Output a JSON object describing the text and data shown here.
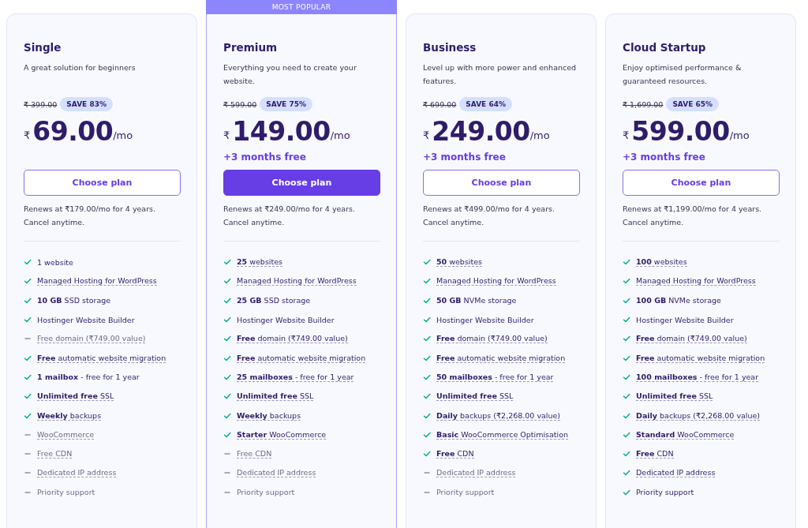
{
  "plans": [
    {
      "name": "Single",
      "popular": false,
      "description": "A great solution for beginners",
      "old_price": "₹ 399.00",
      "save": "SAVE 83%",
      "currency": "₹",
      "price": "69.00",
      "period": "/mo",
      "button": "Choose plan",
      "primary": false,
      "renews": "Renews at ₹179.00/mo for 4 years. Cancel anytime.",
      "features": [
        {
          "text": "1 website",
          "included": true,
          "dashed": false
        },
        {
          "text": "Managed Hosting for WordPress",
          "included": true,
          "dashed": true
        },
        {
          "text": "**10 GB** SSD storage",
          "included": true,
          "dashed": false
        },
        {
          "text": "Hostinger Website Builder",
          "included": true,
          "dashed": false
        },
        {
          "text": "Free domain (₹749.00 value)",
          "included": false,
          "dashed": true
        },
        {
          "text": "**Free** automatic website migration",
          "included": true,
          "dashed": true
        },
        {
          "text": "**1 mailbox** - free for 1 year",
          "included": true,
          "dashed": false
        },
        {
          "text": "**Unlimited free** SSL",
          "included": true,
          "dashed": true
        },
        {
          "text": "**Weekly** backups",
          "included": true,
          "dashed": true
        },
        {
          "text": "WooCommerce",
          "included": false,
          "dashed": true
        },
        {
          "text": "Free CDN",
          "included": false,
          "dashed": true
        },
        {
          "text": "Dedicated IP address",
          "included": false,
          "dashed": true
        },
        {
          "text": "Priority support",
          "included": false,
          "dashed": false
        }
      ]
    },
    {
      "name": "Premium",
      "popular": true,
      "ribbon": "MOST POPULAR",
      "description": "Everything you need to create your website.",
      "old_price": "₹ 599.00",
      "save": "SAVE 75%",
      "currency": "₹",
      "price": "149.00",
      "period": "/mo",
      "bonus": "+3 months free",
      "button": "Choose plan",
      "primary": true,
      "renews": "Renews at ₹249.00/mo for 4 years. Cancel anytime.",
      "features": [
        {
          "text": "**25** websites",
          "included": true,
          "dashed": true
        },
        {
          "text": "Managed Hosting for WordPress",
          "included": true,
          "dashed": true
        },
        {
          "text": "**25 GB** SSD storage",
          "included": true,
          "dashed": false
        },
        {
          "text": "Hostinger Website Builder",
          "included": true,
          "dashed": false
        },
        {
          "text": "**Free** domain (₹749.00 value)",
          "included": true,
          "dashed": true
        },
        {
          "text": "**Free** automatic website migration",
          "included": true,
          "dashed": true
        },
        {
          "text": "**25 mailboxes** - free for 1 year",
          "included": true,
          "dashed": true
        },
        {
          "text": "**Unlimited free** SSL",
          "included": true,
          "dashed": true
        },
        {
          "text": "**Weekly** backups",
          "included": true,
          "dashed": true
        },
        {
          "text": "**Starter** WooCommerce",
          "included": true,
          "dashed": true
        },
        {
          "text": "Free CDN",
          "included": false,
          "dashed": true
        },
        {
          "text": "Dedicated IP address",
          "included": false,
          "dashed": true
        },
        {
          "text": "Priority support",
          "included": false,
          "dashed": false
        }
      ]
    },
    {
      "name": "Business",
      "popular": false,
      "description": "Level up with more power and enhanced features.",
      "old_price": "₹ 699.00",
      "save": "SAVE 64%",
      "currency": "₹",
      "price": "249.00",
      "period": "/mo",
      "bonus": "+3 months free",
      "button": "Choose plan",
      "primary": false,
      "renews": "Renews at ₹499.00/mo for 4 years. Cancel anytime.",
      "features": [
        {
          "text": "**50** websites",
          "included": true,
          "dashed": true
        },
        {
          "text": "Managed Hosting for WordPress",
          "included": true,
          "dashed": true
        },
        {
          "text": "**50 GB** NVMe storage",
          "included": true,
          "dashed": false
        },
        {
          "text": "Hostinger Website Builder",
          "included": true,
          "dashed": false
        },
        {
          "text": "**Free** domain (₹749.00 value)",
          "included": true,
          "dashed": true
        },
        {
          "text": "**Free** automatic website migration",
          "included": true,
          "dashed": true
        },
        {
          "text": "**50 mailboxes** - free for 1 year",
          "included": true,
          "dashed": true
        },
        {
          "text": "**Unlimited free** SSL",
          "included": true,
          "dashed": true
        },
        {
          "text": "**Daily** backups (₹2,268.00 value)",
          "included": true,
          "dashed": true
        },
        {
          "text": "**Basic** WooCommerce Optimisation",
          "included": true,
          "dashed": true
        },
        {
          "text": "**Free** CDN",
          "included": true,
          "dashed": true
        },
        {
          "text": "Dedicated IP address",
          "included": false,
          "dashed": true
        },
        {
          "text": "Priority support",
          "included": false,
          "dashed": false
        }
      ]
    },
    {
      "name": "Cloud Startup",
      "popular": false,
      "description": "Enjoy optimised performance & guaranteed resources.",
      "old_price": "₹ 1,699.00",
      "save": "SAVE 65%",
      "currency": "₹",
      "price": "599.00",
      "period": "/mo",
      "bonus": "+3 months free",
      "button": "Choose plan",
      "primary": false,
      "renews": "Renews at ₹1,199.00/mo for 4 years. Cancel anytime.",
      "features": [
        {
          "text": "**100** websites",
          "included": true,
          "dashed": true
        },
        {
          "text": "Managed Hosting for WordPress",
          "included": true,
          "dashed": true
        },
        {
          "text": "**100 GB** NVMe storage",
          "included": true,
          "dashed": false
        },
        {
          "text": "Hostinger Website Builder",
          "included": true,
          "dashed": false
        },
        {
          "text": "**Free** domain (₹749.00 value)",
          "included": true,
          "dashed": true
        },
        {
          "text": "**Free** automatic website migration",
          "included": true,
          "dashed": true
        },
        {
          "text": "**100 mailboxes** - free for 1 year",
          "included": true,
          "dashed": true
        },
        {
          "text": "**Unlimited free** SSL",
          "included": true,
          "dashed": true
        },
        {
          "text": "**Daily** backups (₹2,268.00 value)",
          "included": true,
          "dashed": true
        },
        {
          "text": "**Standard** WooCommerce",
          "included": true,
          "dashed": true
        },
        {
          "text": "**Free** CDN",
          "included": true,
          "dashed": true
        },
        {
          "text": "Dedicated IP address",
          "included": true,
          "dashed": true
        },
        {
          "text": "Priority support",
          "included": true,
          "dashed": false
        }
      ]
    }
  ]
}
